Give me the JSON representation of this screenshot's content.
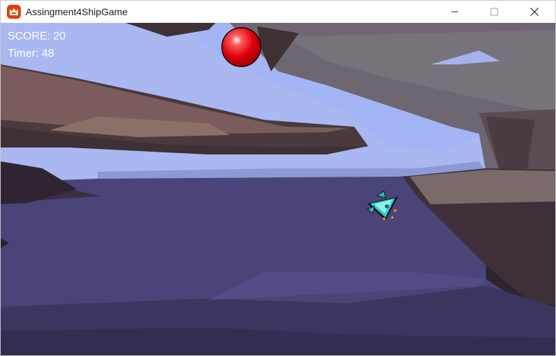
{
  "window": {
    "title": "Assingment4ShipGame",
    "icon": "monogame-logo-icon",
    "controls": [
      "minimize-icon",
      "maximize-icon",
      "close-icon"
    ],
    "accent_color": "#e73c00"
  },
  "hud": {
    "score_label": "SCORE:",
    "score_value": "20",
    "timer_label": "Timer:",
    "timer_value": "48",
    "text_color": "#ffffff"
  },
  "scene": {
    "sky_color": "#a3b5f4",
    "ground_color": "#4a4478",
    "rock_color": "#4a3a3e",
    "ball_color": "#e8000f",
    "ship_color": "#2fd0c8"
  }
}
